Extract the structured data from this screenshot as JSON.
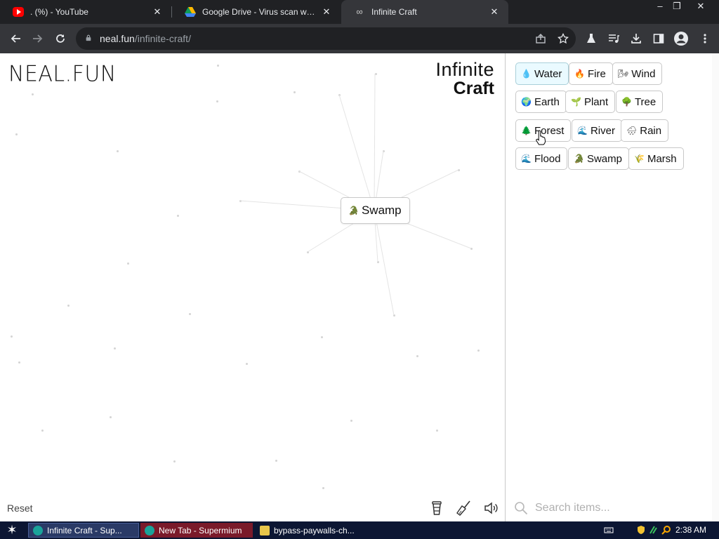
{
  "browser": {
    "tabs": [
      {
        "title": ". (%) - YouTube",
        "favicon": "youtube-icon",
        "active": false
      },
      {
        "title": "Google Drive - Virus scan warning",
        "favicon": "google-drive-icon",
        "active": false
      },
      {
        "title": "Infinite Craft",
        "favicon": "infinity-icon",
        "active": true
      }
    ],
    "url": {
      "host": "neal.fun",
      "path": "/infinite-craft/"
    },
    "accent": "#35363a"
  },
  "page": {
    "logo_left": "NEAL.FUN",
    "logo_right_line1": "Infinite",
    "logo_right_line2": "Craft",
    "canvas_item": {
      "emoji": "🐊",
      "label": "Swamp"
    },
    "reset_label": "Reset",
    "bottom_icons": [
      "coffee-cup-icon",
      "broom-icon",
      "speaker-icon"
    ],
    "sidebar_items": [
      {
        "emoji": "💧",
        "label": "Water"
      },
      {
        "emoji": "🔥",
        "label": "Fire"
      },
      {
        "emoji": "🌬",
        "label": "Wind"
      },
      {
        "emoji": "🌍",
        "label": "Earth"
      },
      {
        "emoji": "🌱",
        "label": "Plant"
      },
      {
        "emoji": "🌳",
        "label": "Tree"
      },
      {
        "emoji": "🌲",
        "label": "Forest"
      },
      {
        "emoji": "🌊",
        "label": "River"
      },
      {
        "emoji": "🌧",
        "label": "Rain"
      },
      {
        "emoji": "🌊",
        "label": "Flood"
      },
      {
        "emoji": "🐊",
        "label": "Swamp"
      },
      {
        "emoji": "🌾",
        "label": "Marsh"
      }
    ],
    "search_placeholder": "Search items..."
  },
  "taskbar": {
    "items": [
      {
        "label": "Infinite Craft - Sup...",
        "icon": "supermium-icon"
      },
      {
        "label": "New Tab - Supermium",
        "icon": "supermium-icon"
      },
      {
        "label": "bypass-paywalls-ch...",
        "icon": "folder-icon"
      }
    ],
    "clock": "2:38 AM"
  }
}
